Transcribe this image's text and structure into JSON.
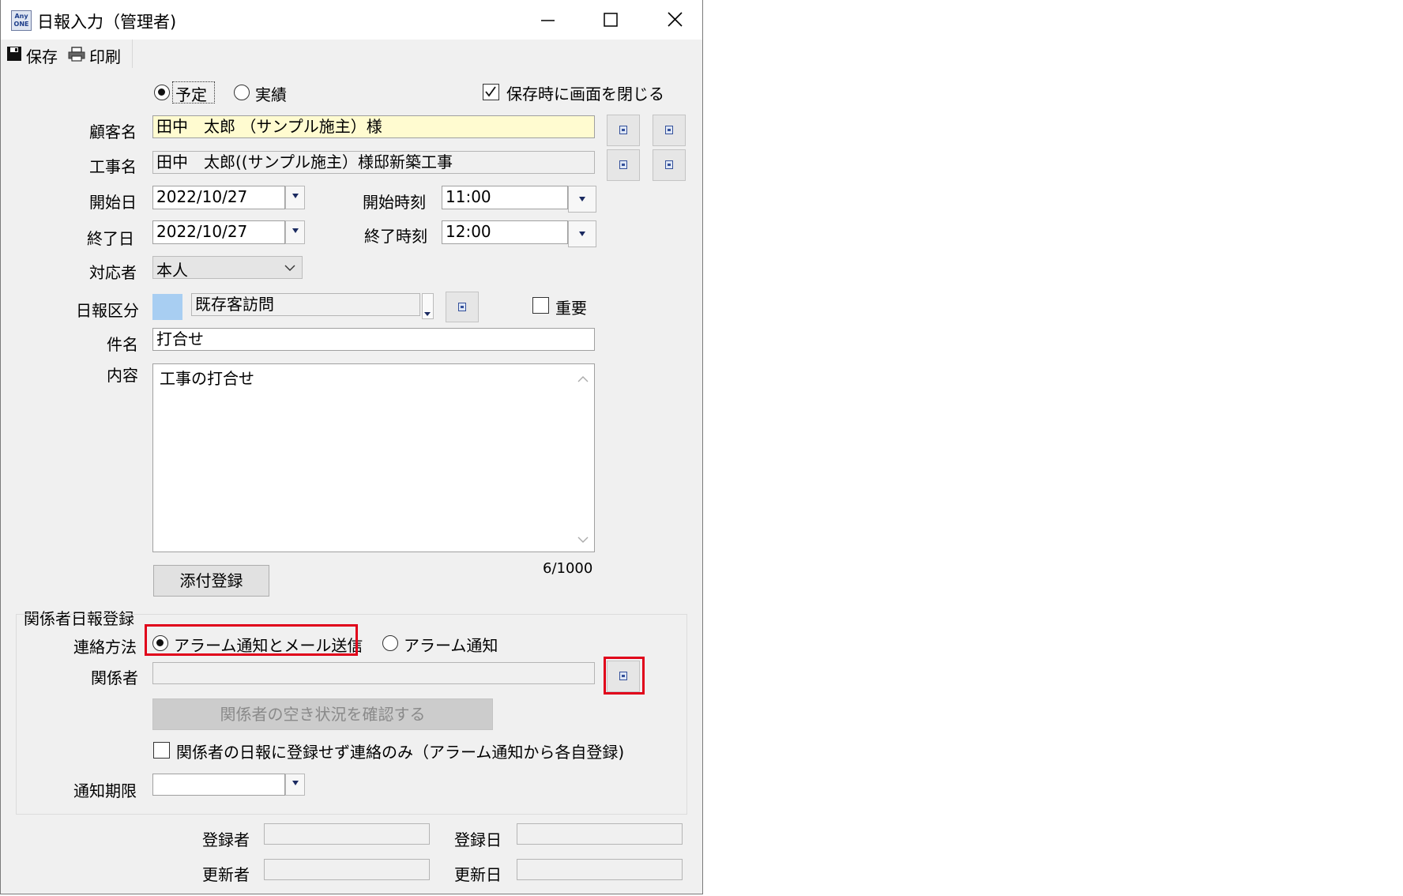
{
  "window": {
    "title": "日報入力（管理者)",
    "app_icon_text_top": "Any",
    "app_icon_text_bottom": "ONE"
  },
  "toolbar": {
    "save_label": "保存",
    "print_label": "印刷"
  },
  "mode": {
    "plan_label": "予定",
    "actual_label": "実績",
    "selected": "予定"
  },
  "close_on_save": {
    "label": "保存時に画面を閉じる",
    "checked": true
  },
  "customer": {
    "label": "顧客名",
    "value": "田中　太郎 （サンプル施主）様"
  },
  "project": {
    "label": "工事名",
    "value": "田中　太郎((サンプル施主）様邸新築工事"
  },
  "start_date": {
    "label": "開始日",
    "value": "2022/10/27"
  },
  "end_date": {
    "label": "終了日",
    "value": "2022/10/27"
  },
  "start_time": {
    "label": "開始時刻",
    "value": "11:00"
  },
  "end_time": {
    "label": "終了時刻",
    "value": "12:00"
  },
  "responder": {
    "label": "対応者",
    "value": "本人"
  },
  "report_type": {
    "label": "日報区分",
    "value": "既存客訪問",
    "swatch_color": "#a8cef2"
  },
  "important": {
    "label": "重要",
    "checked": false
  },
  "subject": {
    "label": "件名",
    "value": "打合せ"
  },
  "content": {
    "label": "内容",
    "value": "工事の打合せ",
    "counter": "6/1000"
  },
  "attach_button": "添付登録",
  "related": {
    "section_label": "関係者日報登録",
    "contact_method_label": "連絡方法",
    "option_alarm_mail": "アラーム通知とメール送信",
    "option_alarm": "アラーム通知",
    "selected": "アラーム通知とメール送信",
    "persons_label": "関係者",
    "persons_value": "",
    "check_availability_button": "関係者の空き状況を確認する",
    "contact_only_label": "関係者の日報に登録せず連絡のみ（アラーム通知から各自登録)",
    "contact_only_checked": false,
    "deadline_label": "通知期限",
    "deadline_value": ""
  },
  "footer": {
    "registered_by_label": "登録者",
    "registered_date_label": "登録日",
    "updated_by_label": "更新者",
    "updated_date_label": "更新日"
  },
  "colors": {
    "highlight_red": "#e0001a",
    "window_bg": "#f0f0f0",
    "customer_field_bg": "#fffbd0"
  }
}
